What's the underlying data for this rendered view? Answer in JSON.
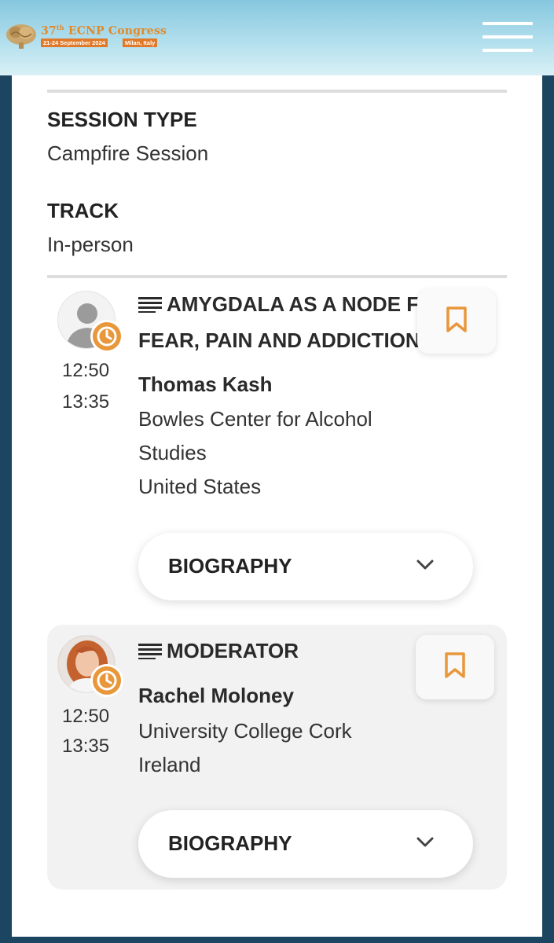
{
  "header": {
    "logo_title_num": "37",
    "logo_title_sup": "th",
    "logo_title_rest": " ECNP Congress",
    "logo_dates": "21-24 September 2024",
    "logo_place": "Milan, Italy"
  },
  "session": {
    "type_label": "SESSION TYPE",
    "type_value": "Campfire Session",
    "track_label": "TRACK",
    "track_value": "In-person"
  },
  "presentations": [
    {
      "title_line1": "AMYGDALA AS A NODE FOR",
      "title_line2": "FEAR, PAIN AND ADDICTION",
      "time_start": "12:50",
      "time_end": "13:35",
      "speaker": "Thomas Kash",
      "affil_line1": "Bowles Center for Alcohol",
      "affil_line2": "Studies",
      "affil_line3": "United States",
      "bio_label": "BIOGRAPHY"
    },
    {
      "title_line1": "MODERATOR",
      "time_start": "12:50",
      "time_end": "13:35",
      "speaker": "Rachel Moloney",
      "affil_line1": "University College Cork",
      "affil_line2": "Ireland",
      "bio_label": "BIOGRAPHY"
    }
  ],
  "colors": {
    "accent": "#e8973a",
    "page_bg": "#1b4560",
    "header_top": "#86c7df"
  },
  "icons": [
    "hamburger-menu-icon",
    "clock-icon",
    "list-lines-icon",
    "bookmark-icon",
    "chevron-down-icon",
    "person-placeholder-icon"
  ]
}
